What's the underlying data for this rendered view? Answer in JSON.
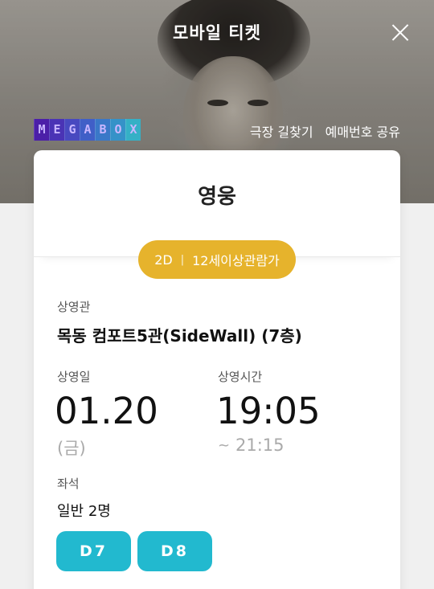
{
  "header": {
    "title": "모바일 티켓",
    "links": [
      "극장 길찾기",
      "예매번호 공유"
    ]
  },
  "brand": {
    "logo_text": "MEGABOX",
    "logo_letters": [
      "M",
      "E",
      "G",
      "A",
      "B",
      "O",
      "X"
    ],
    "logo_colors": [
      "#4b1fa8",
      "#4a33b5",
      "#4849c0",
      "#405fc7",
      "#3a78c8",
      "#3592c8",
      "#35b0c6"
    ]
  },
  "movie": {
    "title": "영웅",
    "format": "2D",
    "separator": "|",
    "rating": "12세이상관람가"
  },
  "theater": {
    "label": "상영관",
    "value": "목동 컴포트5관(SideWall) (7층)"
  },
  "date": {
    "label": "상영일",
    "value": "01.20",
    "weekday": "(금)"
  },
  "time": {
    "label": "상영시간",
    "start": "19:05",
    "tilde": "~",
    "end": "21:15"
  },
  "seats": {
    "label": "좌석",
    "summary": "일반 2명",
    "items": [
      "D7",
      "D8"
    ]
  },
  "colors": {
    "badge": "#e6b32c",
    "seat_button": "#22b9cf"
  }
}
